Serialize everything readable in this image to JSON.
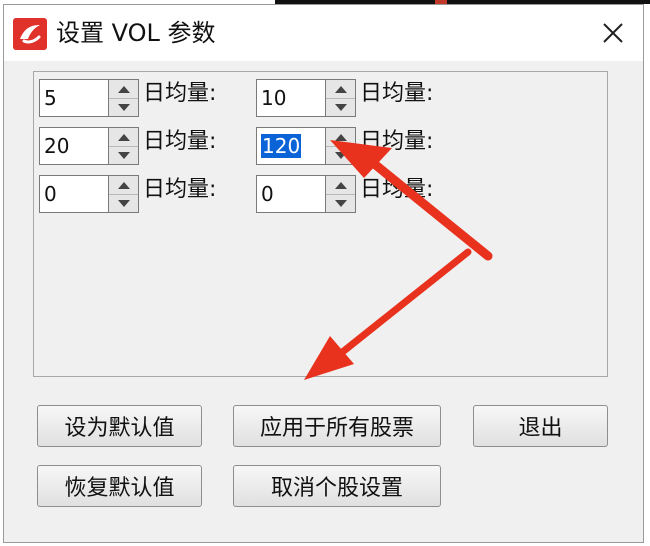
{
  "window": {
    "title": "设置 VOL 参数",
    "close_symbol": "✕"
  },
  "fields": [
    {
      "value": "5",
      "label": "日均量:",
      "selected": false
    },
    {
      "value": "10",
      "label": "日均量:",
      "selected": false
    },
    {
      "value": "20",
      "label": "日均量:",
      "selected": false
    },
    {
      "value": "120",
      "label": "日均量:",
      "selected": true
    },
    {
      "value": "0",
      "label": "日均量:",
      "selected": false
    },
    {
      "value": "0",
      "label": "日均量:",
      "selected": false
    }
  ],
  "buttons": {
    "set_default": "设为默认值",
    "apply_all": "应用于所有股票",
    "exit": "退出",
    "restore_default": "恢复默认值",
    "cancel_stock": "取消个股设置"
  },
  "colors": {
    "selection": "#0a64d8",
    "annotation_arrow": "#e8321e",
    "app_icon": "#e0322a"
  }
}
